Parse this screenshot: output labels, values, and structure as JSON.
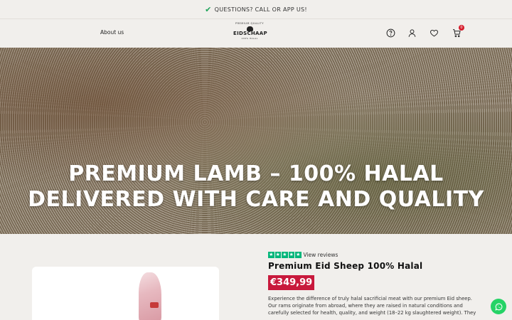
{
  "announcement": {
    "text": "QUESTIONS? CALL OR APP US!"
  },
  "header": {
    "nav_about": "About us",
    "logo": {
      "arc_text": "PREMIUM QUALITY",
      "name": "EIDSCHAAP",
      "sub_text": "100% HALAL"
    },
    "cart_count": "0"
  },
  "hero": {
    "headline": "PREMIUM LAMB – 100% HALAL DELIVERED WITH CARE AND QUALITY"
  },
  "product": {
    "rating_stars": 5,
    "reviews_link": "View reviews",
    "title": "Premium Eid Sheep 100% Halal",
    "price": "€349,99",
    "description": "Experience the difference of truly halal sacrificial meat with our premium Eid sheep. Our rams originate from abroad, where they are raised in natural conditions and carefully selected for health, quality, and weight (18–22 kg slaughtered weight). They"
  },
  "colors": {
    "accent_price": "#c8193c",
    "trustpilot_green": "#00b67a",
    "whatsapp_green": "#25d366",
    "cart_badge": "#d51b2a"
  }
}
